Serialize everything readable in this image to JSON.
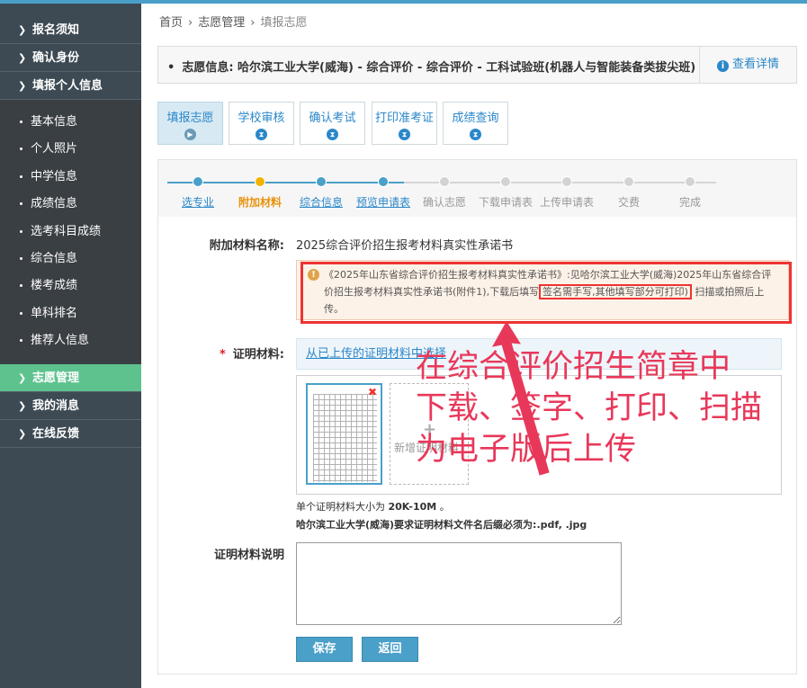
{
  "sidebar": {
    "groups_top": [
      {
        "label": "报名须知"
      },
      {
        "label": "确认身份"
      },
      {
        "label": "填报个人信息"
      }
    ],
    "sub_items": [
      {
        "label": "基本信息"
      },
      {
        "label": "个人照片"
      },
      {
        "label": "中学信息"
      },
      {
        "label": "成绩信息"
      },
      {
        "label": "选考科目成绩"
      },
      {
        "label": "综合信息"
      },
      {
        "label": "楼考成绩"
      },
      {
        "label": "单科排名"
      },
      {
        "label": "推荐人信息"
      }
    ],
    "groups_bottom": [
      {
        "label": "志愿管理"
      },
      {
        "label": "我的消息"
      },
      {
        "label": "在线反馈"
      }
    ],
    "active_color": "#5ec28f"
  },
  "breadcrumb": {
    "home": "首页",
    "section": "志愿管理",
    "current": "填报志愿"
  },
  "info_bar": {
    "text": "志愿信息:  哈尔滨工业大学(威海)  -  综合评价  -  综合评价  -  工科试验班(机器人与智能装备类拔尖班)",
    "detail_label": "查看详情"
  },
  "tabs": [
    {
      "label": "填报志愿"
    },
    {
      "label": "学校审核"
    },
    {
      "label": "确认考试"
    },
    {
      "label": "打印准考证"
    },
    {
      "label": "成绩查询"
    }
  ],
  "steps": [
    {
      "label": "选专业",
      "state": "done"
    },
    {
      "label": "附加材料",
      "state": "current"
    },
    {
      "label": "综合信息",
      "state": "done"
    },
    {
      "label": "预览申请表",
      "state": "done"
    },
    {
      "label": "确认志愿",
      "state": "todo"
    },
    {
      "label": "下载申请表",
      "state": "todo"
    },
    {
      "label": "上传申请表",
      "state": "todo"
    },
    {
      "label": "交费",
      "state": "todo"
    },
    {
      "label": "完成",
      "state": "todo"
    }
  ],
  "form": {
    "material_name_label": "附加材料名称:",
    "material_name_value": "2025综合评价招生报考材料真实性承诺书",
    "notice_text_a": "《2025年山东省综合评价招生报考材料真实性承诺书》:见哈尔滨工业大学(威海)2025年山东省综合评价招生报考材料真实性承诺书(附件1),下载后填写",
    "notice_boxed": "签名需手写,其他填写部分可打印)",
    "notice_text_b": "扫描或拍照后上传。",
    "proof_label": "证明材料:",
    "required_mark": "*",
    "select_link": "从已上传的证明材料中选择",
    "add_label": "新增证明材料",
    "hint_size_prefix": "单个证明材料大小为 ",
    "hint_size_value": "20K-10M",
    "hint_size_suffix": " 。",
    "hint_ext": "哈尔滨工业大学(威海)要求证明材料文件名后缀必须为:.pdf, .jpg",
    "desc_label": "证明材料说明",
    "desc_value": "",
    "save_label": "保存",
    "back_label": "返回"
  },
  "annotation": {
    "line1": "在综合评价招生简章中",
    "line2": "下载、签字、打印、扫描",
    "line3": "为电子版后上传",
    "color": "#e8385a"
  },
  "colors": {
    "accent": "#2a87c9",
    "highlight": "#e33",
    "step_current": "#f3b200"
  }
}
